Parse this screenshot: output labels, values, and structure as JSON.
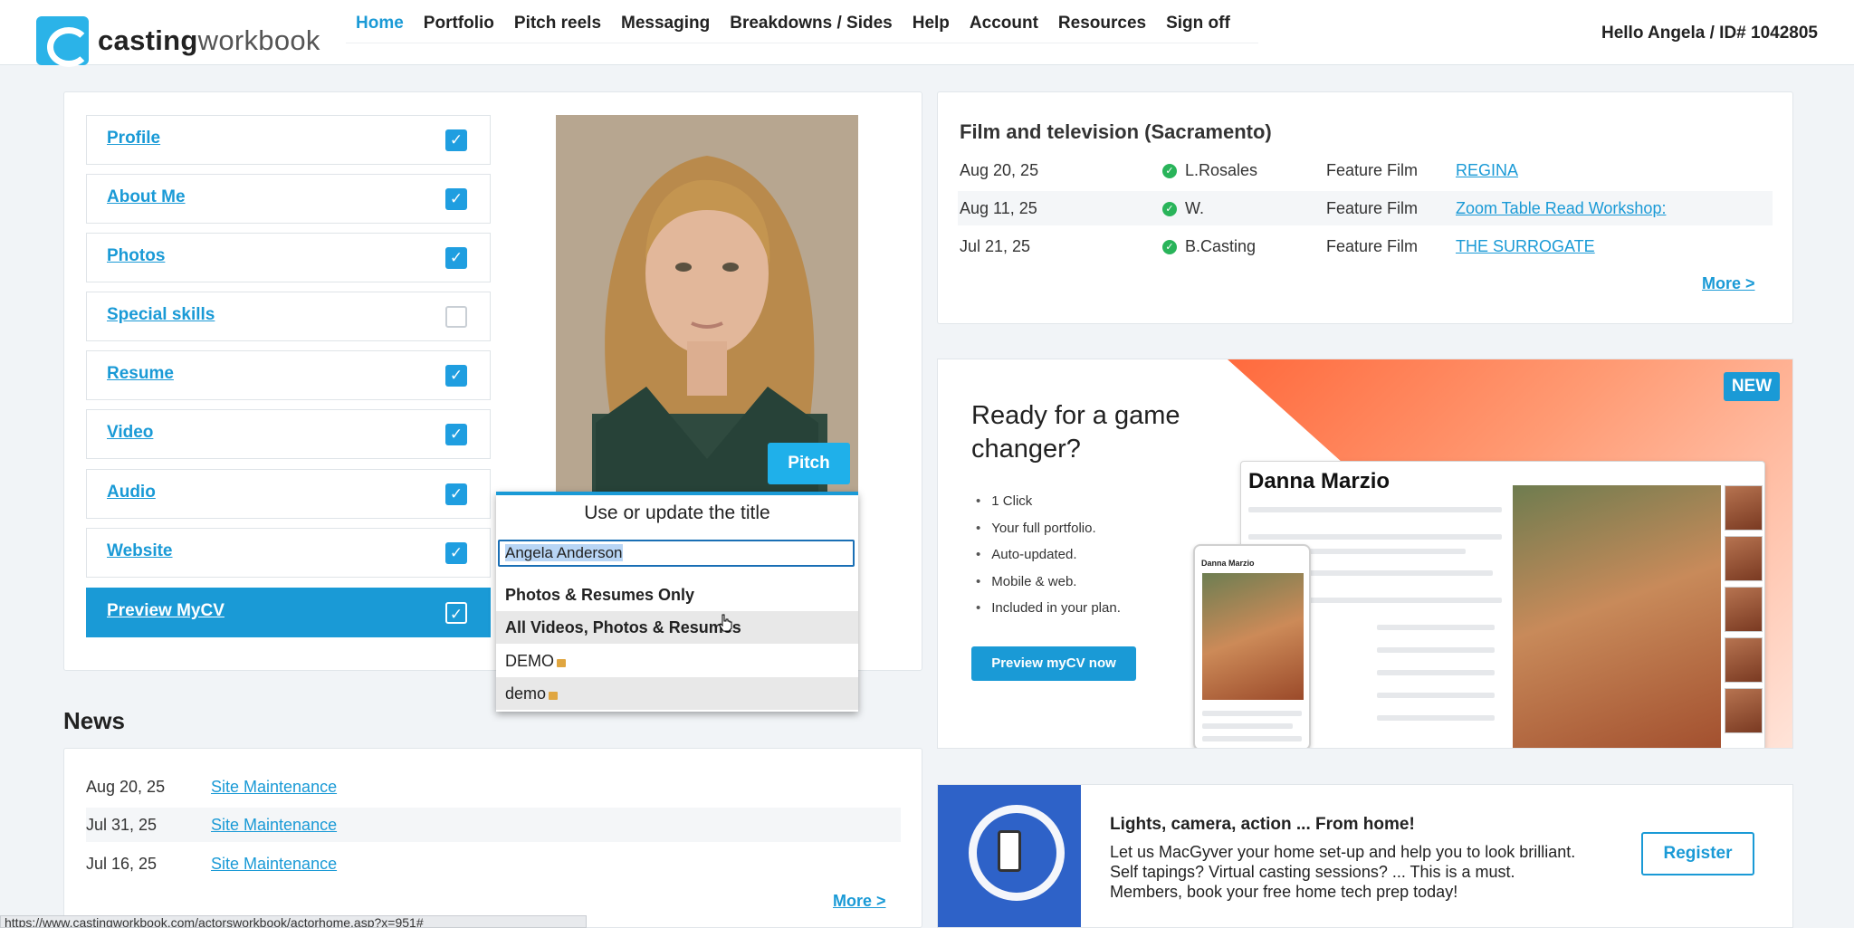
{
  "header": {
    "logo_bold": "casting",
    "logo_light": "workbook",
    "nav": [
      "Home",
      "Portfolio",
      "Pitch reels",
      "Messaging",
      "Breakdowns / Sides",
      "Help",
      "Account",
      "Resources",
      "Sign off"
    ],
    "hello": "Hello Angela / ID# 1042805"
  },
  "profile_checklist": [
    {
      "label": "Profile",
      "checked": true
    },
    {
      "label": "About Me",
      "checked": true
    },
    {
      "label": "Photos",
      "checked": true
    },
    {
      "label": "Special skills",
      "checked": false
    },
    {
      "label": "Resume",
      "checked": true
    },
    {
      "label": "Video",
      "checked": true
    },
    {
      "label": "Audio",
      "checked": true
    },
    {
      "label": "Website",
      "checked": true
    },
    {
      "label": "Preview MyCV",
      "checked": true
    }
  ],
  "pitch_button": "Pitch",
  "pitch_dropdown": {
    "title": "Use or update the title",
    "input_value": "Angela Anderson",
    "options": [
      "Photos & Resumes Only",
      "All Videos, Photos & Resumes",
      "DEMO",
      "demo"
    ]
  },
  "auditions": {
    "title": "Film and television (Sacramento)",
    "rows": [
      {
        "date": "Aug 20, 25",
        "name": "L.Rosales",
        "type": "Feature Film",
        "project": "REGINA"
      },
      {
        "date": "Aug 11, 25",
        "name": "W.",
        "type": "Feature Film",
        "project": "Zoom Table Read Workshop:"
      },
      {
        "date": "Jul 21, 25",
        "name": "B.Casting",
        "type": "Feature Film",
        "project": "THE SURROGATE"
      }
    ],
    "more": "More >"
  },
  "promo": {
    "badge": "NEW",
    "headline": "Ready for a game changer?",
    "bullets": [
      "1 Click",
      "Your full portfolio.",
      "Auto-updated.",
      "Mobile & web.",
      "Included in your plan."
    ],
    "button": "Preview myCV now",
    "mock_name": "Danna Marzio"
  },
  "news": {
    "title": "News",
    "rows": [
      {
        "date": "Aug 20, 25",
        "link": "Site Maintenance"
      },
      {
        "date": "Jul 31, 25",
        "link": "Site Maintenance"
      },
      {
        "date": "Jul 16, 25",
        "link": "Site Maintenance"
      }
    ],
    "more": "More >"
  },
  "home_tech": {
    "title": "Lights, camera, action ... From home!",
    "text": "Let us MacGyver your home set-up and help you to look brilliant. Self tapings? Virtual casting sessions? ... This is a must. Members, book your free home tech prep today!",
    "button": "Register"
  },
  "status_url": "https://www.castingworkbook.com/actorsworkbook/actorhome.asp?x=951#"
}
